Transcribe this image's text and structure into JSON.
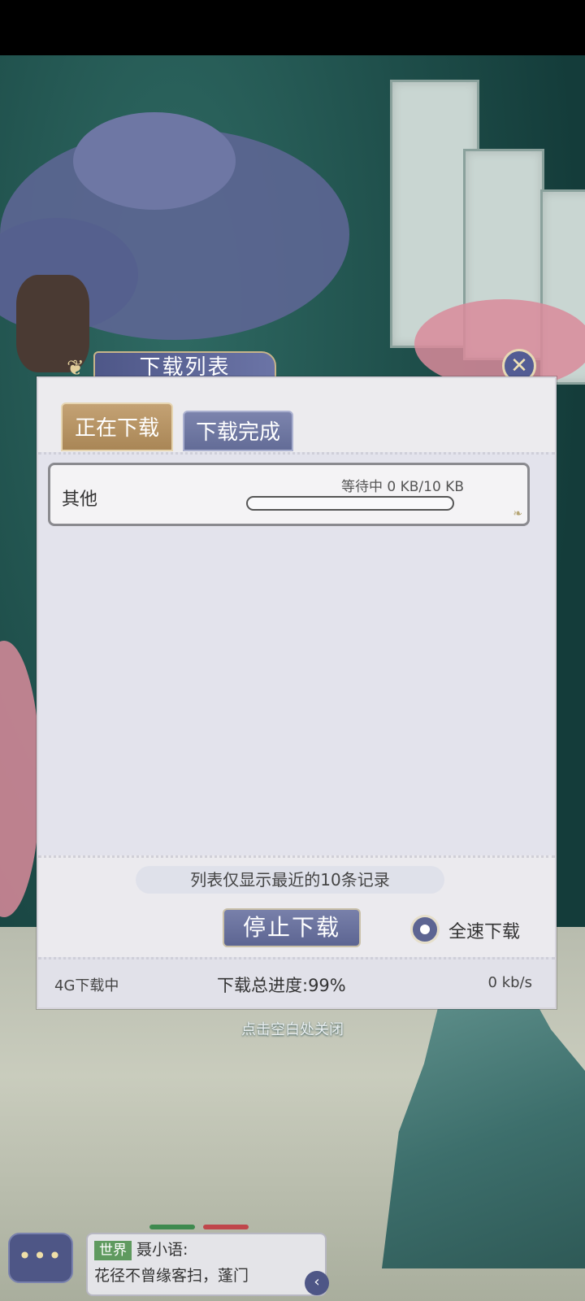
{
  "dialog": {
    "title": "下载列表",
    "close_icon": "x-icon",
    "tabs": [
      {
        "label": "正在下载",
        "active": true
      },
      {
        "label": "下载完成",
        "active": false
      }
    ],
    "items": [
      {
        "label": "其他",
        "status": "等待中 0 KB/10 KB",
        "progress": 0
      }
    ],
    "notice": "列表仅显示最近的10条记录",
    "stop_button": "停止下载",
    "full_speed_label": "全速下载",
    "network_status": "4G下载中",
    "total_progress": "下载总进度:99%",
    "speed": "0 kb/s"
  },
  "close_hint": "点击空白处关闭",
  "chat": {
    "button_label": "•••",
    "channel": "世界",
    "sender": "聂小语:",
    "message": "花径不曾缘客扫，蓬门",
    "expand_icon": "chevron-left-icon"
  },
  "colors": {
    "accent_gold": "#c4a274",
    "accent_indigo": "#5d6592",
    "chat_tag_green": "#5f9a5f",
    "chan_green": "#3e8a4f",
    "chan_red": "#c0464b"
  }
}
